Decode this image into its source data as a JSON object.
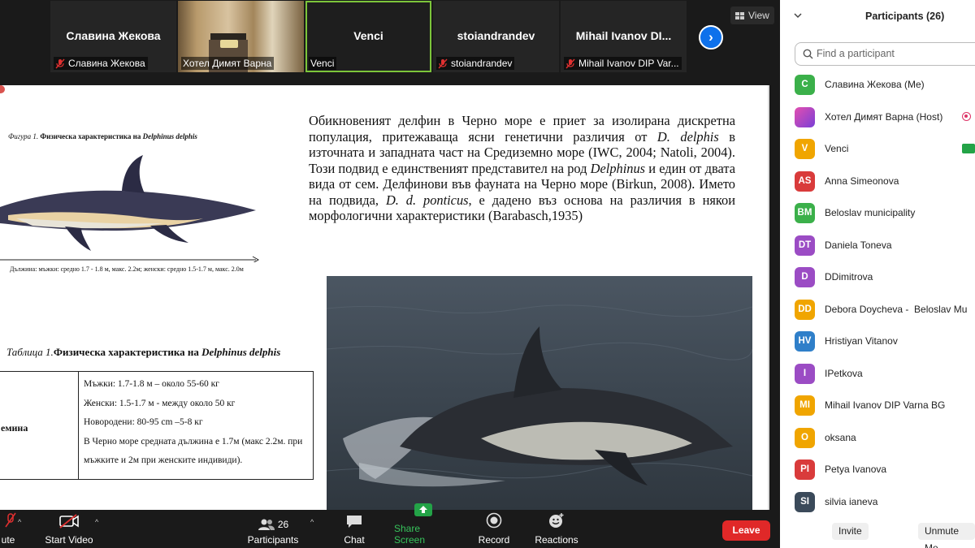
{
  "thumbnails": [
    {
      "name": "Славина Жекова",
      "caption": "Славина Жекова",
      "muted": true
    },
    {
      "name": "",
      "caption": "Хотел Димят Варна",
      "muted": false
    },
    {
      "name": "Venci",
      "caption": "Venci",
      "muted": false,
      "active": true
    },
    {
      "name": "stoiandrandev",
      "caption": "stoiandrandev",
      "muted": true
    },
    {
      "name": "Mihail Ivanov DI...",
      "caption": "Mihail Ivanov DIP Var...",
      "muted": true
    }
  ],
  "view_label": "View",
  "slide": {
    "figure_caption_prefix": "Фигура 1.",
    "figure_caption_title": " Физическа характеристика на ",
    "figure_caption_species": "Delphinus delphis",
    "length_caption": "Дължина: мъжки: средно 1.7 - 1.8 м, макс. 2.2м; женски: средно 1.5-1.7 м, макс. 2.0м",
    "table_caption_prefix": "Таблица 1.",
    "table_caption_title": "Физическа характеристика на ",
    "table_caption_species": "Delphinus delphis",
    "table_row_header": "емина",
    "table_rows": [
      "Мъжки:      1.7-1.8 м – около 55-60  кг",
      "Женски: 1.5-1.7 м - между около 50 кг",
      "Новородени:  80-95 cm –5-8  кг",
      "В Черно море средната дължина е 1.7м (макс 2.2м. при",
      "мъжките и 2м при женските индивиди)."
    ],
    "paragraph": {
      "p1": "Обикновеният делфин в Черно море е приет за изолирана дискретна популация, притежаваща ясни генетични различия от ",
      "i1": "D. delphis",
      "p2": " в източната и западната част на Средиземно море (IWC, 2004; Natoli, 2004). Този подвид е единственият представител на род ",
      "i2": "Delphinus",
      "p3": " и един от двата вида от сем. Делфинови във фауната на Черно море (Birkun, 2008). Името на подвида, ",
      "i3": "D. d. ponticus",
      "p4": ", е дадено въз основа на различия в някои морфологични характеристики (Barabasch,1935)"
    }
  },
  "toolbar": {
    "mute_label": "ute",
    "start_video_label": "Start Video",
    "participants_label": "Participants",
    "participants_count": "26",
    "chat_label": "Chat",
    "share_screen_label": "Share Screen",
    "record_label": "Record",
    "reactions_label": "Reactions",
    "leave_label": "Leave"
  },
  "panel": {
    "title": "Participants (26)",
    "search_placeholder": "Find a participant",
    "participants": [
      {
        "initials": "С",
        "name": "Славина Жекова (Me)",
        "color": "#3bb04a"
      },
      {
        "initials": "",
        "name": "Хотел Димят Варна (Host)",
        "color": "#b04ac9",
        "badge": "host"
      },
      {
        "initials": "V",
        "name": "Venci",
        "color": "#f0a500",
        "badge": "share"
      },
      {
        "initials": "AS",
        "name": "Anna Simeonova",
        "color": "#d93b3b"
      },
      {
        "initials": "BM",
        "name": "Beloslav municipality",
        "color": "#3bb04a"
      },
      {
        "initials": "DT",
        "name": "Daniela Toneva",
        "color": "#9b4cc4"
      },
      {
        "initials": "D",
        "name": "DDimitrova",
        "color": "#9b4cc4"
      },
      {
        "initials": "DD",
        "name": "Debora Doycheva -  Beloslav Mu",
        "color": "#f0a500"
      },
      {
        "initials": "HV",
        "name": "Hristiyan Vitanov",
        "color": "#2f7fc9"
      },
      {
        "initials": "I",
        "name": "IPetkova",
        "color": "#9b4cc4"
      },
      {
        "initials": "MI",
        "name": "Mihail Ivanov DIP Varna BG",
        "color": "#f0a500"
      },
      {
        "initials": "O",
        "name": "oksana",
        "color": "#f0a500"
      },
      {
        "initials": "PI",
        "name": "Petya Ivanova",
        "color": "#d93b3b"
      },
      {
        "initials": "SI",
        "name": "silvia ianeva",
        "color": "#3b4a5a"
      }
    ],
    "invite_label": "Invite",
    "unmute_me_label": "Unmute Me"
  }
}
